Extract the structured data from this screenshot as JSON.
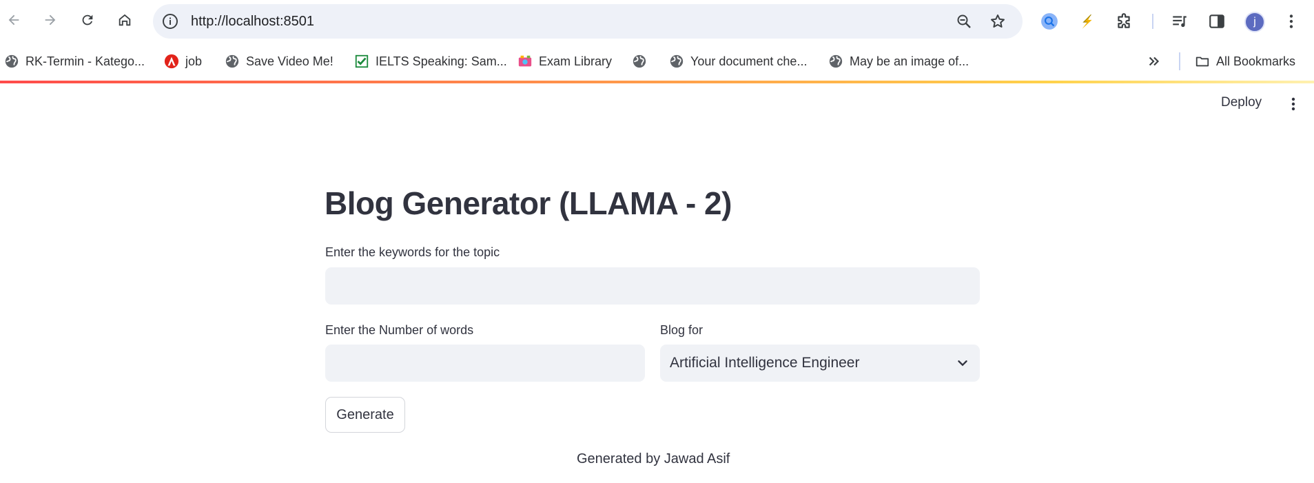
{
  "browser": {
    "url": "http://localhost:8501",
    "profile_initial": "j",
    "bookmarks": [
      {
        "label": "RK-Termin - Katego...",
        "icon": "globe-icon"
      },
      {
        "label": "job",
        "icon": "arbeitsagentur-icon"
      },
      {
        "label": "Save Video Me!",
        "icon": "globe-icon"
      },
      {
        "label": "IELTS Speaking: Sam...",
        "icon": "checkbox-icon"
      },
      {
        "label": "Exam Library",
        "icon": "exam-library-icon"
      },
      {
        "label": "",
        "icon": "globe-icon"
      },
      {
        "label": "Your document che...",
        "icon": "globe-icon"
      },
      {
        "label": "May be an image of...",
        "icon": "globe-icon"
      }
    ],
    "all_bookmarks_label": "All Bookmarks"
  },
  "app": {
    "deploy_label": "Deploy",
    "title": "Blog Generator (LLAMA - 2)",
    "keywords_label": "Enter the keywords for the topic",
    "keywords_value": "",
    "words_label": "Enter the Number of words",
    "words_value": "",
    "blog_for_label": "Blog for",
    "blog_for_selected": "Artificial Intelligence Engineer",
    "generate_label": "Generate",
    "footer": "Generated by Jawad Asif"
  },
  "colors": {
    "accent": "#ff4b4b",
    "input_bg": "#f0f2f6",
    "text": "#31333f"
  }
}
